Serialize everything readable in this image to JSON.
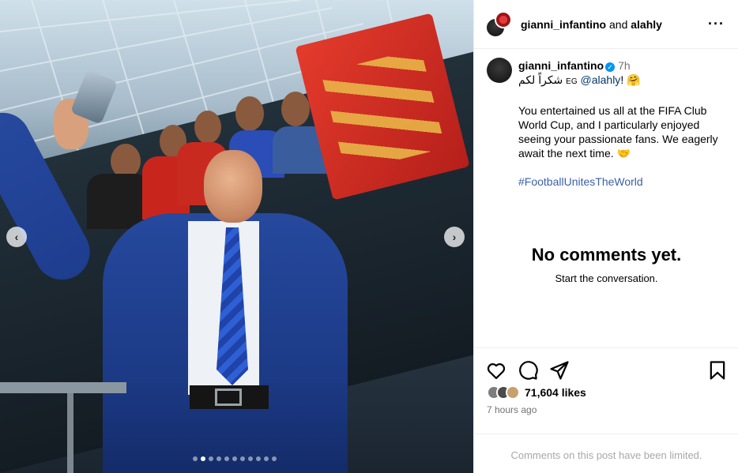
{
  "post": {
    "header": {
      "user1": "gianni_infantino",
      "joiner": "and",
      "user2": "alahly",
      "more_icon": "more-horizontal-icon"
    },
    "caption": {
      "username": "gianni_infantino",
      "verified_icon": "verified-badge-icon",
      "time": "7h",
      "line1_arabic": "شكراً لكم",
      "line1_flag": "EG",
      "line1_mention": "@alahly",
      "line1_end": "!",
      "line1_emoji": "🤗",
      "paragraph": "You entertained us all at the FIFA Club World Cup, and I particularly enjoyed seeing your passionate fans. We eagerly await the next time.",
      "paragraph_emoji": "🤝",
      "hashtag": "#FootballUnitesTheWorld"
    },
    "comments": {
      "empty_title": "No comments yet.",
      "empty_subtitle": "Start the conversation."
    },
    "actions": {
      "like_icon": "heart-icon",
      "comment_icon": "comment-icon",
      "share_icon": "send-icon",
      "save_icon": "bookmark-icon"
    },
    "likes": "71,604 likes",
    "time_ago": "7 hours ago",
    "limited_notice": "Comments on this post have been limited."
  },
  "media": {
    "prev_icon": "chevron-left-icon",
    "next_icon": "chevron-right-icon",
    "carousel_count": 11,
    "carousel_active": 2
  },
  "colors": {
    "link": "#00376b",
    "hashtag": "#3b5fa8",
    "verified": "#0095f6",
    "muted": "#737373"
  }
}
